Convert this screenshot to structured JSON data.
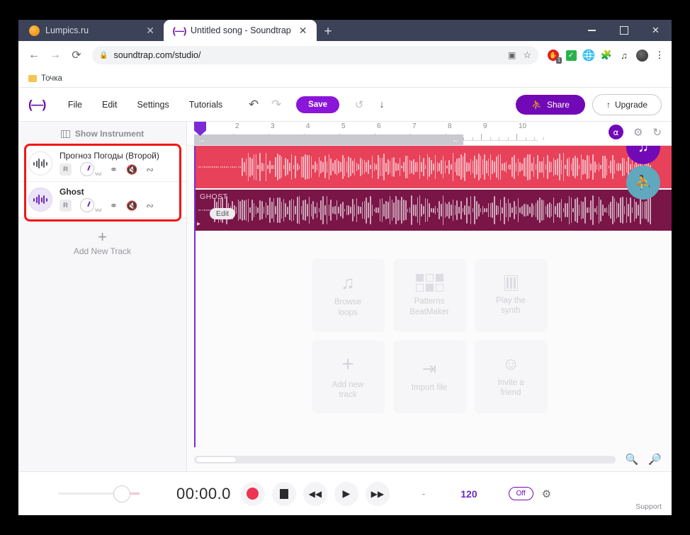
{
  "browser": {
    "tabs": [
      {
        "title": "Lumpics.ru",
        "favicon": "orange-circle-icon",
        "active": false
      },
      {
        "title": "Untitled song - Soundtrap",
        "favicon": "soundtrap-logo-icon",
        "active": true
      }
    ],
    "new_tab_label": "+",
    "window_controls": {
      "minimize": "—",
      "maximize": "□",
      "close": "✕"
    },
    "nav": {
      "back": "←",
      "forward": "→",
      "reload": "⟳"
    },
    "omnibox": {
      "url": "soundtrap.com/studio/",
      "lock_icon": "lock-icon"
    },
    "omnibox_actions": {
      "translate": "translate-icon",
      "bookmark": "star-icon"
    },
    "extensions": [
      {
        "name": "adblock-icon",
        "glyph": "✋",
        "badge": "1"
      },
      {
        "name": "checkmark-icon",
        "glyph": "✓"
      },
      {
        "name": "globe-icon",
        "glyph": "⊕"
      },
      {
        "name": "puzzle-icon",
        "glyph": "❖"
      },
      {
        "name": "playlist-music-icon",
        "glyph": "≡"
      }
    ],
    "profile": "avatar",
    "menu": "⋮",
    "bookmarks": [
      {
        "label": "Точка",
        "icon": "folder-icon"
      }
    ]
  },
  "app": {
    "logo": "(—)",
    "menu": [
      "File",
      "Edit",
      "Settings",
      "Tutorials"
    ],
    "undo_icon": "↶",
    "redo_icon": "↷",
    "save_label": "Save",
    "revert_icon": "↺",
    "download_icon": "↓",
    "share_label": "Share",
    "share_icon": "people-icon",
    "upgrade_label": "Upgrade",
    "upgrade_icon": "↑",
    "colors": {
      "purple": "#7209b7",
      "save_purple": "#8a16d9",
      "track_red": "#e8415a",
      "track_magenta": "#7a1548",
      "teal": "#5fa8bd",
      "highlight_red": "#f21616"
    }
  },
  "tracks_panel": {
    "header": "Show Instrument",
    "header_icon": "instrument-grid-icon",
    "tracks": [
      {
        "name": "Прогноз Погоды (Второй)",
        "thumb": "audio-wave-icon",
        "record_label": "R",
        "vol_label": "Vol",
        "solo_icon": "headphones-icon",
        "mute_icon": "speaker-muted-icon",
        "automation_icon": "automation-curve-icon"
      },
      {
        "name": "Ghost",
        "thumb": "audio-wave-icon",
        "record_label": "R",
        "vol_label": "Vol",
        "solo_icon": "headphones-icon",
        "mute_icon": "speaker-muted-icon",
        "automation_icon": "automation-curve-icon"
      }
    ],
    "add_track_label": "Add New Track",
    "add_track_icon": "plus-icon"
  },
  "timeline": {
    "ruler_labels": [
      "2",
      "3",
      "4",
      "5",
      "6",
      "7",
      "8",
      "9",
      "10"
    ],
    "loop_start_icon": "→",
    "loop_end_icon": "←",
    "tools": {
      "snap_icon": "magnet-icon",
      "settings_icon": "gear-icon",
      "loop_icon": "loop-icon"
    },
    "fabs": {
      "music": "music-note-icon",
      "people": "people-icon"
    },
    "regions": [
      {
        "name": "",
        "color": "#e8415a",
        "label": ""
      },
      {
        "name": "GHOST",
        "color": "#7a1548",
        "label": "GHOST",
        "edit_label": "Edit"
      }
    ]
  },
  "cards": [
    {
      "label": "Browse\nloops",
      "icon": "music-note-icon",
      "glyph": "♫"
    },
    {
      "label": "Patterns\nBeatMaker",
      "icon": "pattern-grid-icon",
      "glyph": "▣"
    },
    {
      "label": "Play the\nsynth",
      "icon": "piano-keys-icon",
      "glyph": "█"
    },
    {
      "label": "Add new\ntrack",
      "icon": "plus-icon",
      "glyph": "＋"
    },
    {
      "label": "Import file",
      "icon": "import-arrow-icon",
      "glyph": "→]"
    },
    {
      "label": "Invite a\nfriend",
      "icon": "person-plus-icon",
      "glyph": "☺⁺"
    }
  ],
  "scrollbar": {
    "zoom_in_icon": "zoom-in-icon",
    "zoom_out_icon": "zoom-out-icon"
  },
  "transport": {
    "time": "00:00.0",
    "record_icon": "record-icon",
    "stop_icon": "stop-icon",
    "rewind_icon": "◀◀",
    "play_icon": "▶",
    "forward_icon": "▶▶",
    "separator": "-",
    "bpm": "120",
    "metronome_label": "Off",
    "settings_icon": "gear-icon",
    "support_label": "Support"
  }
}
